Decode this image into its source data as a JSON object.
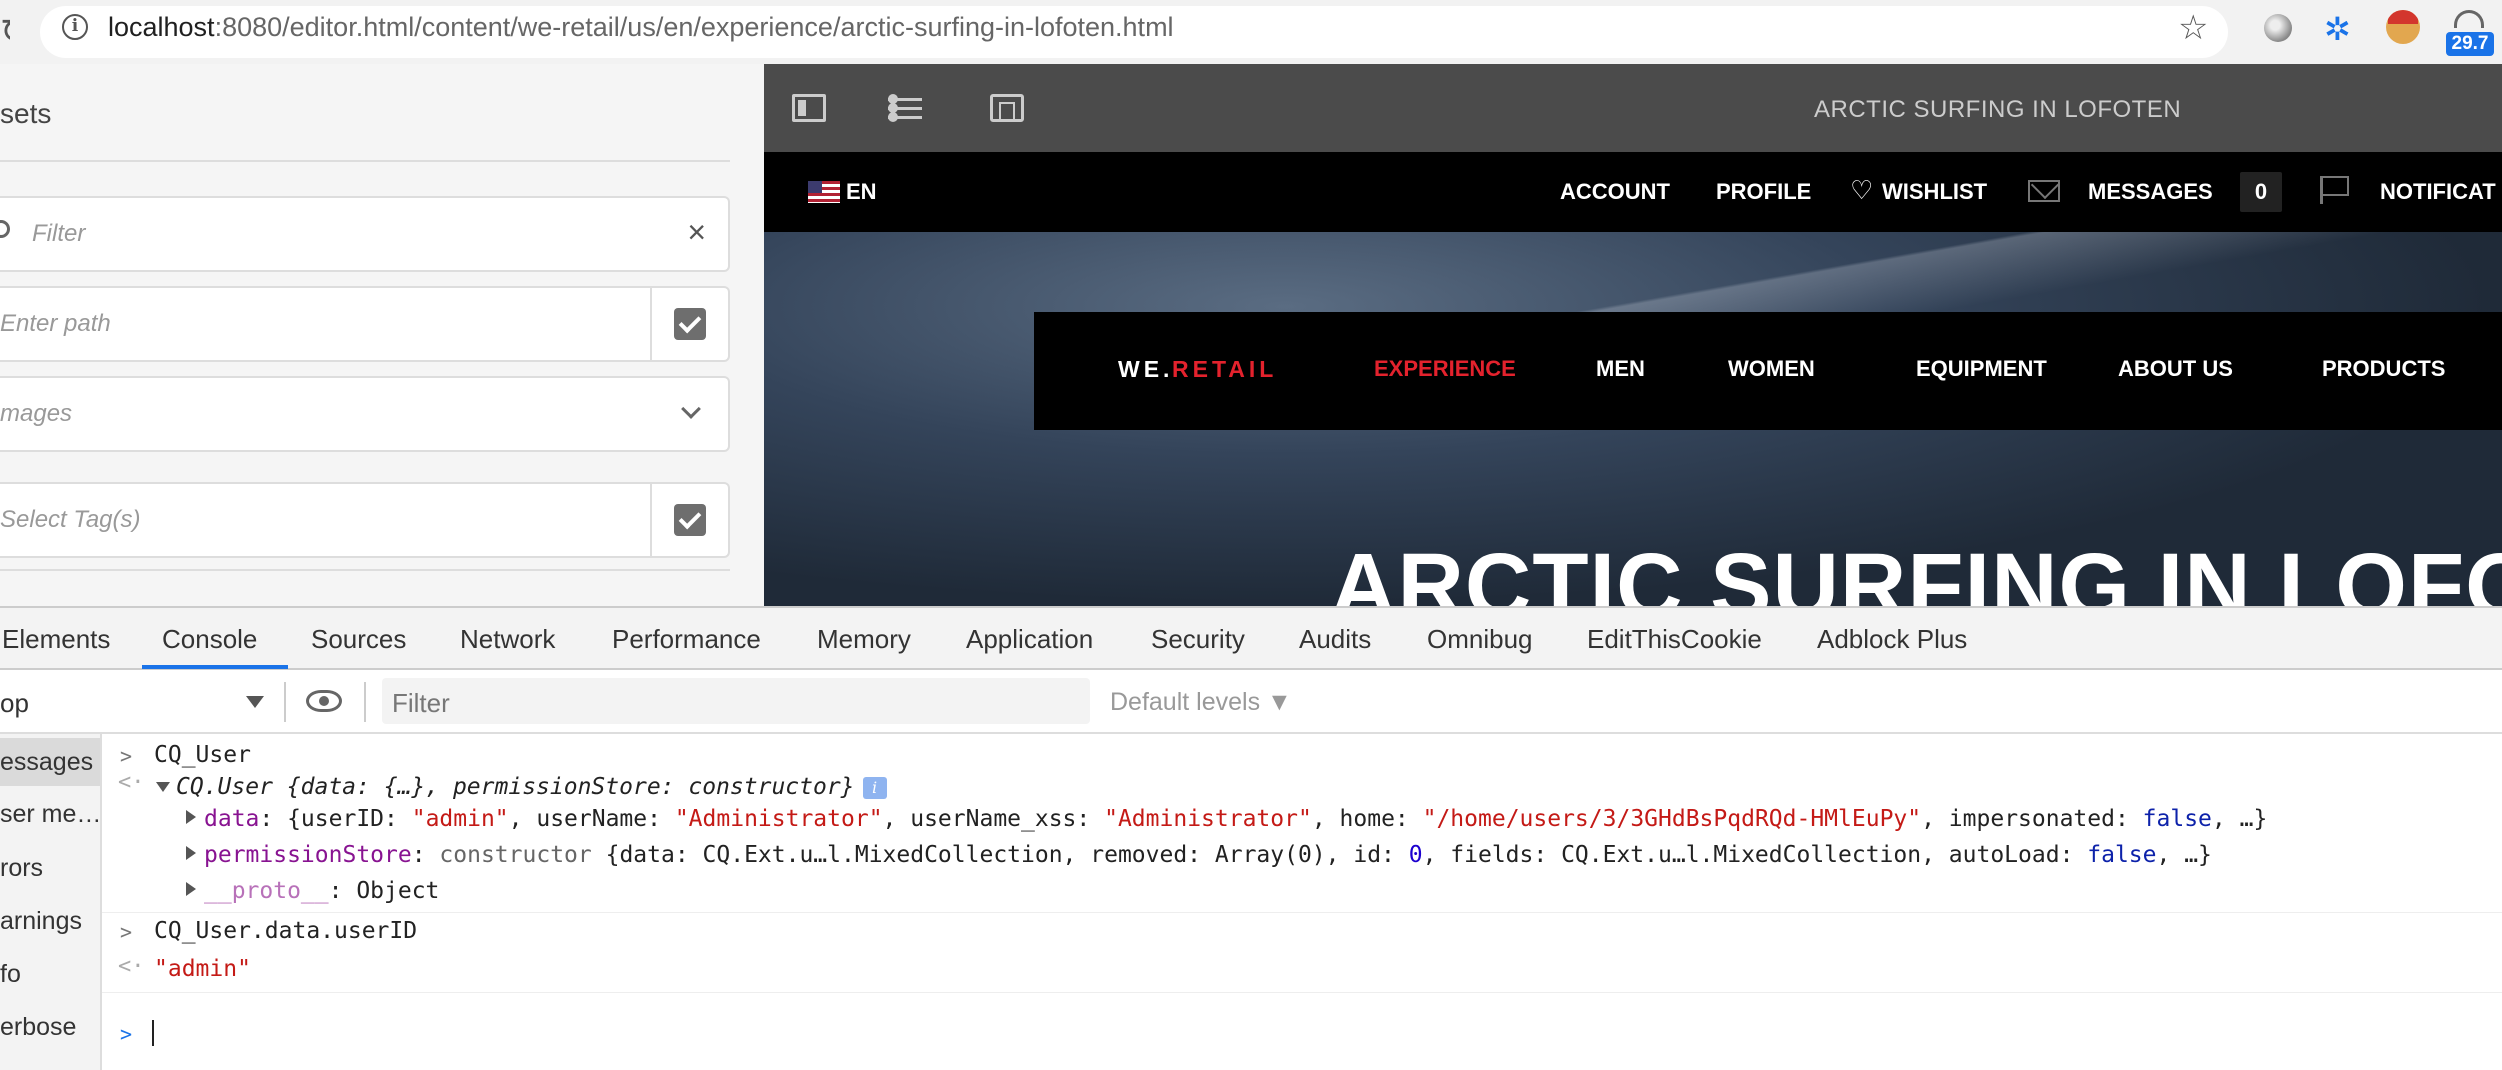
{
  "browser": {
    "url_host": "localhost",
    "url_rest": ":8080/editor.html/content/we-retail/us/en/experience/arctic-surfing-in-lofoten.html",
    "extension_badge": "29.7"
  },
  "assets_panel": {
    "title": "sets",
    "filter_placeholder": "Filter",
    "path_placeholder": "Enter path",
    "type_select_value": "mages",
    "tags_placeholder": "Select Tag(s)"
  },
  "editor": {
    "page_name": "ARCTIC SURFING IN LOFOTEN"
  },
  "site": {
    "language": "EN",
    "top_nav": [
      "ACCOUNT",
      "PROFILE",
      "WISHLIST",
      "MESSAGES",
      "NOTIFICAT"
    ],
    "message_count": "0",
    "brand_we": "WE.",
    "brand_retail": "RETAIL",
    "main_nav": [
      "EXPERIENCE",
      "MEN",
      "WOMEN",
      "EQUIPMENT",
      "ABOUT US",
      "PRODUCTS"
    ],
    "hero_title": "ARCTIC SURFING IN LOFO"
  },
  "devtools": {
    "tabs": [
      "Elements",
      "Console",
      "Sources",
      "Network",
      "Performance",
      "Memory",
      "Application",
      "Security",
      "Audits",
      "Omnibug",
      "EditThisCookie",
      "Adblock Plus"
    ],
    "active_tab": "Console",
    "context": "op",
    "filter_placeholder": "Filter",
    "levels": "Default levels ▼",
    "sidebar": [
      "essages",
      "ser me…",
      "rors",
      "arnings",
      "fo",
      "erbose"
    ],
    "console": {
      "cmd1": "CQ_User",
      "obj_header_class": "CQ.User",
      "obj_header_rest": "{data: {…}, permissionStore: constructor}",
      "info_badge": "i",
      "data_key": "data",
      "data_summary": {
        "open": ": {userID: ",
        "userID": "\"admin\"",
        "p2": ", userName: ",
        "userName": "\"Administrator\"",
        "p3": ", userName_xss: ",
        "userName_xss": "\"Administrator\"",
        "p4": ", home: ",
        "home": "\"/home/users/3/3GHdBsPqdRQd-HMlEuPy\"",
        "p5": ", impersonated: ",
        "impersonated": "false",
        "close": ", …}"
      },
      "perm_key": "permissionStore",
      "perm_summary": {
        "type": "constructor",
        "p1": " {data: CQ.Ext.u…l.MixedCollection, removed: Array(0), id: ",
        "id": "0",
        "p2": ", fields: CQ.Ext.u…l.MixedCollection, autoLoad: ",
        "autoLoad": "false",
        "close": ", …}"
      },
      "proto_key": "__proto__",
      "proto_value": ": Object",
      "cmd2": "CQ_User.data.userID",
      "result2": "\"admin\""
    }
  }
}
